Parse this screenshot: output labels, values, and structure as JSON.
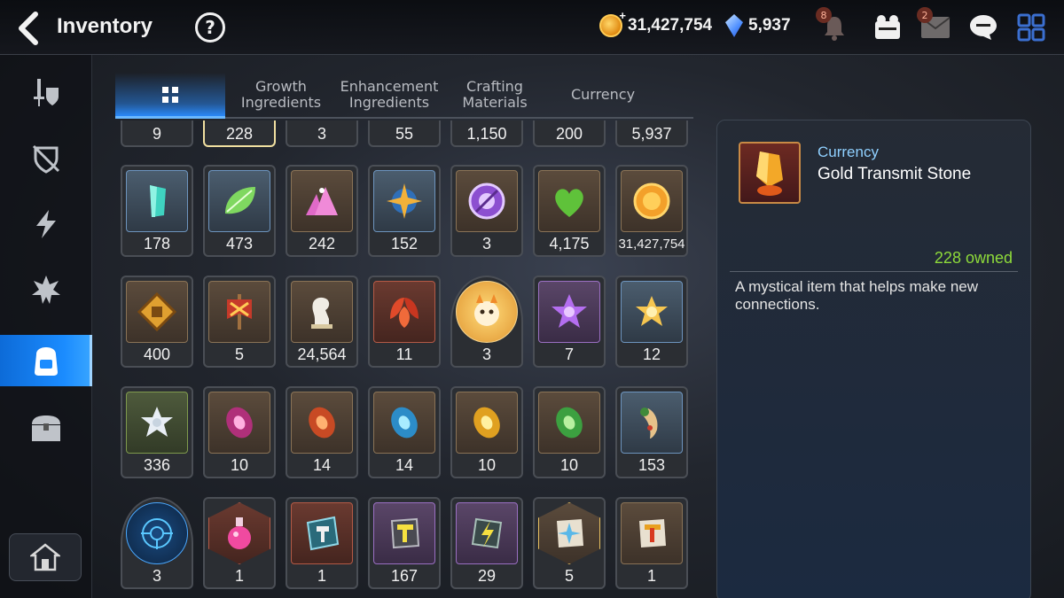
{
  "header": {
    "title": "Inventory",
    "help_glyph": "?",
    "gold": "31,427,754",
    "gems": "5,937",
    "notification_badge": "8",
    "mail_badge": "2"
  },
  "icons": {
    "back": "chevron-left-icon",
    "help": "question-icon",
    "gold": "gold-coin-icon",
    "gem": "crystal-icon",
    "bell": "bell-icon",
    "team": "team-icon",
    "mail": "mail-icon",
    "chat": "chat-icon",
    "menu": "grid-menu-icon"
  },
  "tabs": [
    {
      "label": ""
    },
    {
      "label": "Growth\nIngredients"
    },
    {
      "label": "Enhancement\nIngredients"
    },
    {
      "label": "Crafting\nMaterials"
    },
    {
      "label": "Currency"
    }
  ],
  "items": {
    "row0": [
      "9",
      "228",
      "3",
      "55",
      "1,150",
      "200",
      "5,937"
    ],
    "row1": [
      "178",
      "473",
      "242",
      "152",
      "3",
      "4,175",
      "31,427,754"
    ],
    "row2": [
      "400",
      "5",
      "24,564",
      "11",
      "3",
      "7",
      "12"
    ],
    "row3": [
      "336",
      "10",
      "14",
      "14",
      "10",
      "10",
      "153"
    ],
    "row4": [
      "3",
      "1",
      "1",
      "167",
      "29",
      "5",
      "1"
    ]
  },
  "detail": {
    "category": "Currency",
    "name": "Gold Transmit Stone",
    "owned": "228 owned",
    "description": "A mystical item that helps make new connections."
  },
  "colors": {
    "accent": "#1b8cff",
    "owned": "#8edb3a",
    "category": "#8fd0ff",
    "selected_border": "#f0dfa0"
  }
}
